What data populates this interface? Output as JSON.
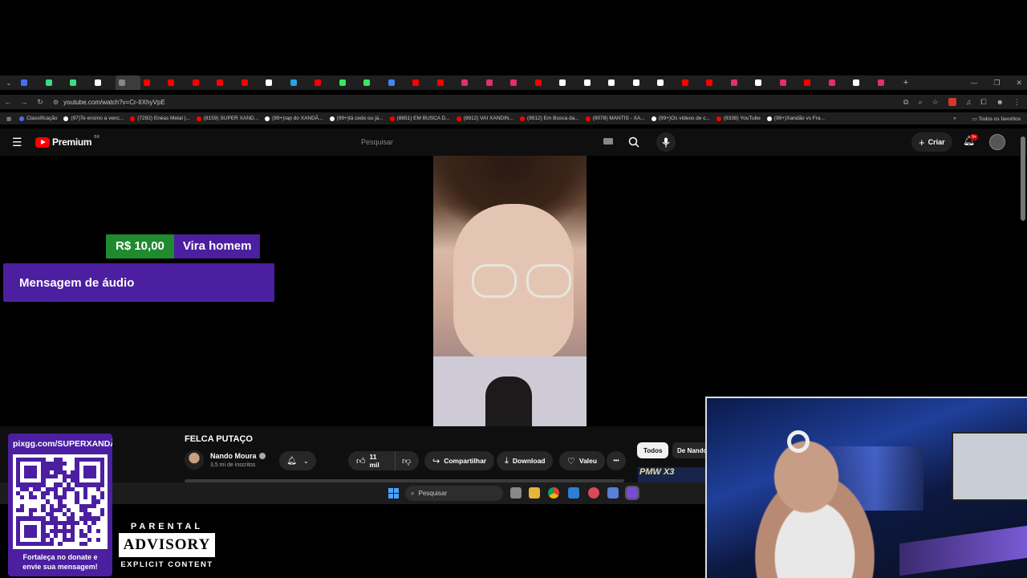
{
  "browser": {
    "tab_count": 40,
    "url": "youtube.com/watch?v=Cr-IIXhyVpE",
    "bookmarks": [
      {
        "label": "Classificação",
        "color": "#4a6cf7"
      },
      {
        "label": "(97)Te ensino a venc...",
        "color": "#ffffff"
      },
      {
        "label": "(7292) Enéas Metal |...",
        "color": "#ff0000"
      },
      {
        "label": "(8159) SUPER XAND...",
        "color": "#ff0000"
      },
      {
        "label": "(99+)rap do XANDÃ...",
        "color": "#ffffff"
      },
      {
        "label": "(99+)tá cedo ou já...",
        "color": "#ffffff"
      },
      {
        "label": "(8851) EM BUSCA D...",
        "color": "#ff0000"
      },
      {
        "label": "(8912) VAI XANDIN...",
        "color": "#ff0000"
      },
      {
        "label": "(8912) Em Busca da...",
        "color": "#ff0000"
      },
      {
        "label": "(9078) MANTIS - XA...",
        "color": "#ff0000"
      },
      {
        "label": "(99+)Os vídeos de c...",
        "color": "#ffffff"
      },
      {
        "label": "(9338) YouTube",
        "color": "#ff0000"
      },
      {
        "label": "(99+)Xandão vs Fra...",
        "color": "#ffffff"
      }
    ],
    "bookmarks_overflow": "»",
    "all_favorites": "Todos os favoritos"
  },
  "youtube": {
    "logo_text": "Premium",
    "logo_country": "BR",
    "search_placeholder": "Pesquisar",
    "create_label": "Criar",
    "notification_badge": "9+",
    "video_title": "FELCA PUTAÇO",
    "channel_name": "Nando Moura",
    "channel_subs": "3,5 mi de inscritos",
    "likes": "11 mil",
    "share_label": "Compartilhar",
    "download_label": "Download",
    "thanks_label": "Valeu",
    "more_label": "•••",
    "filter_all": "Todos",
    "filter_from": "De Nando",
    "thumb_text": "PMW X3"
  },
  "overlay": {
    "donation_amount": "R$ 10,00",
    "donation_message": "Vira homem",
    "donation_type": "Mensagem de áudio",
    "qr_url": "pixgg.com/SUPERXANDÃO",
    "qr_caption_1": "Fortaleça no donate e",
    "qr_caption_2": "envie sua mensagem!",
    "parental_top": "PARENTAL",
    "parental_mid": "ADVISORY",
    "parental_bottom": "EXPLICIT CONTENT"
  },
  "taskbar": {
    "search_placeholder": "Pesquisar"
  },
  "colors": {
    "donation_green": "#1f8a2e",
    "donation_purple": "#4b1fa0",
    "youtube_red": "#ff0000"
  }
}
